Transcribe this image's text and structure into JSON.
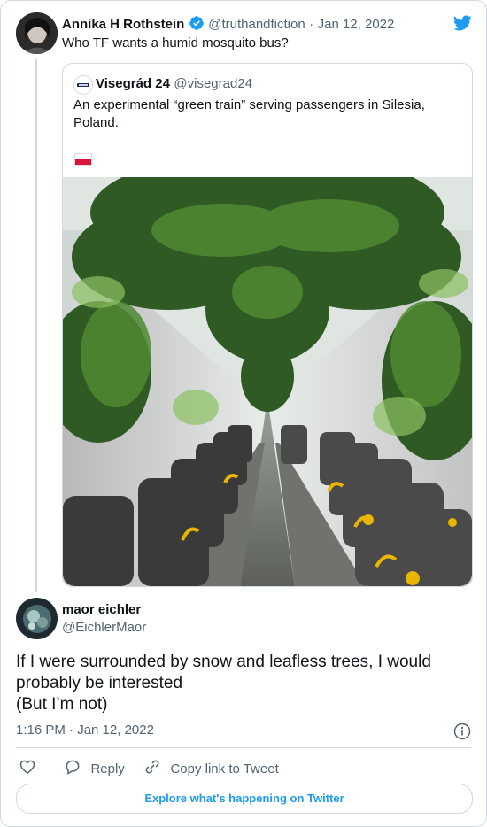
{
  "tweet": {
    "author_name": "Annika H Rothstein",
    "handle": "@truthandfiction",
    "separator": "·",
    "date": "Jan 12, 2022",
    "text": "Who TF wants a humid mosquito bus?"
  },
  "quoted": {
    "author_name": "Visegrád 24",
    "handle": "@visegrad24",
    "text_line1": "An experimental “green train” serving passengers in Silesia,",
    "text_line2": "Poland.",
    "flag_colors": [
      "#ffffff",
      "#dc143c"
    ],
    "image_alt": "Train interior with hanging ferns and plants above the seats"
  },
  "reply": {
    "author_name": "maor eichler",
    "handle": "@EichlerMaor",
    "text_line1": "If I were surrounded by snow and leafless trees, I would",
    "text_line2": "probably be interested",
    "text_line3": "(But I’m not)",
    "timestamp": "1:16 PM · Jan 12, 2022"
  },
  "actions": {
    "reply_label": "Reply",
    "copy_label": "Copy link to Tweet"
  },
  "footer": {
    "explore_label": "Explore what's happening on Twitter"
  },
  "colors": {
    "accent": "#1d9bf0",
    "muted": "#536471",
    "border": "#cfd9de"
  },
  "icons": [
    "twitter-bird-icon",
    "verified-badge-icon",
    "info-icon",
    "heart-icon",
    "reply-icon",
    "link-icon"
  ]
}
